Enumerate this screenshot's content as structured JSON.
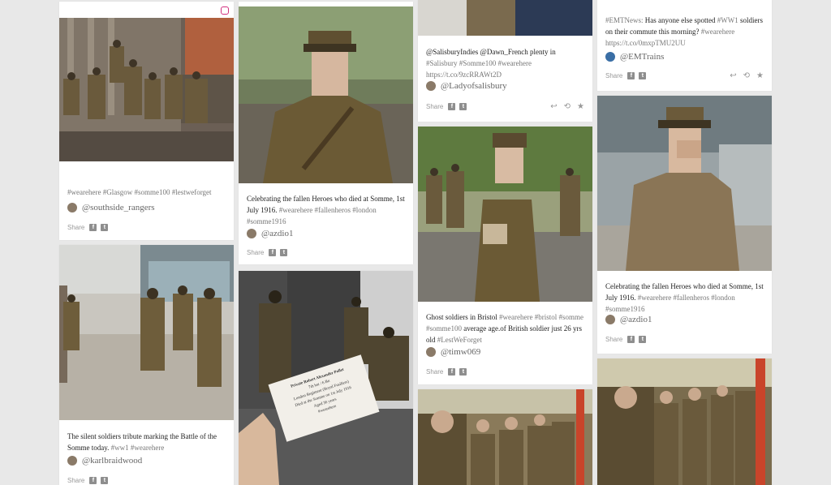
{
  "cards": {
    "c1": {
      "caption": "#wearehere #Glasgow #somme100 #lestweforget",
      "handle": "@southside_rangers",
      "share": "Share"
    },
    "c2": {
      "caption": "Celebrating the fallen Heroes who died at Somme, 1st July 1916.",
      "tags": "#wearehere #fallenheros #london #somme1916",
      "handle": "@azdio1",
      "share": "Share"
    },
    "c3": {
      "caption": "The silent soldiers tribute marking the Battle of the Somme today.",
      "tags": "#ww1 #wearehere",
      "handle": "@karlbraidwood",
      "share": "Share"
    },
    "c5": {
      "caption": "@SalisburyIndies @Dawn_French plenty in",
      "tags": "#Salisbury #Somme100 #wearehere https://t.co/9zcRRAWt2D",
      "handle": "@Ladyofsalisbury",
      "share": "Share"
    },
    "c6": {
      "caption": "Ghost soldiers in Bristol",
      "tags": "#wearehere #bristol #somme #somme100",
      "caption2": "average age.of British soldier just 26 yrs old",
      "tags2": "#LestWeForget",
      "handle": "@timw069",
      "share": "Share"
    },
    "c8": {
      "caption_tag": "#EMTNews:",
      "caption": "Has anyone else spotted",
      "tags": "#WW1",
      "caption2": "soldiers on their commute this morning?",
      "tags2": "#wearehere https://t.co/0mxpTMU2UU",
      "handle": "@EMTrains",
      "share": "Share"
    },
    "c9": {
      "caption": "Celebrating the fallen Heroes who died at Somme, 1st July 1916.",
      "tags": "#wearehere #fallenheros #london #somme1916",
      "handle": "@azdio1",
      "share": "Share"
    }
  },
  "note_card": {
    "line1": "Private Robert Alexander Pollet",
    "line2": "7th bat / 6 Bn",
    "line3": "London Regiment (Royal Fusiliers)",
    "line4": "Died at the Somme on 1st July 1916",
    "line5": "Aged 36 years",
    "line6": "#wearehere"
  },
  "icons": {
    "facebook": "f",
    "twitter": "t",
    "reply": "↩",
    "retweet": "⟲",
    "favorite": "★"
  },
  "colors": {
    "instagram": "#d2307e",
    "twitter": "#3aa1e8",
    "background": "#e8e8e8"
  }
}
